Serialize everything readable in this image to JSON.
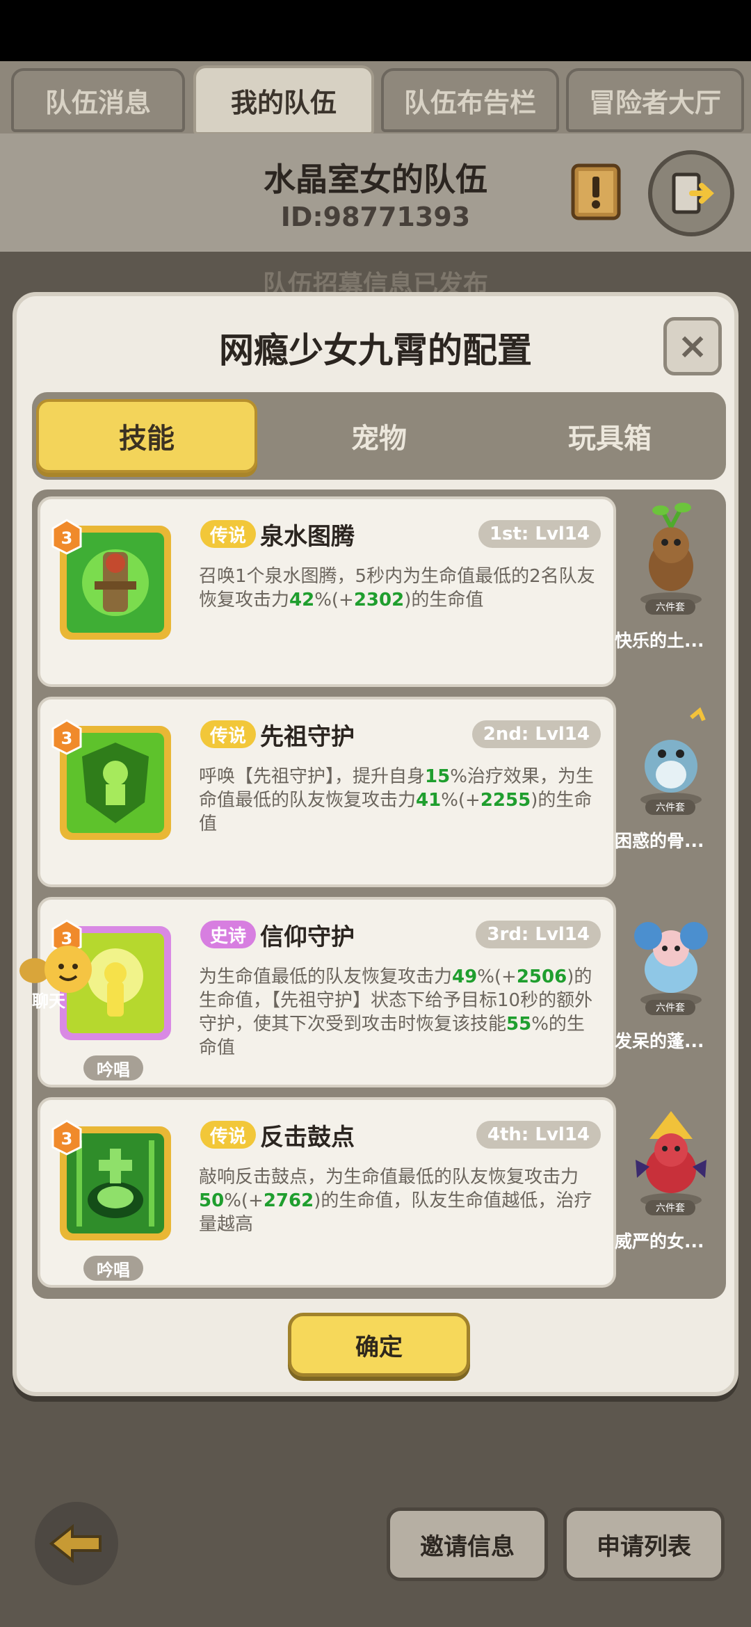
{
  "top_tabs": [
    "队伍消息",
    "我的队伍",
    "队伍布告栏",
    "冒险者大厅"
  ],
  "team": {
    "name": "水晶室女的队伍",
    "id": "ID:98771393",
    "banner": "队伍招募信息已发布"
  },
  "modal": {
    "title": "网瘾少女九霄的配置",
    "close_symbol": "×",
    "tabs": [
      "技能",
      "宠物",
      "玩具箱"
    ],
    "confirm_label": "确定"
  },
  "skills": [
    {
      "rarity": "传说",
      "name": "泉水图腾",
      "level": "1st: Lvl14",
      "badge": "3",
      "chant": "",
      "desc_parts": [
        "召唤1个泉水图腾，5秒内为生命值最低的2名队友恢复攻击力",
        "42",
        "%(+",
        "2302",
        ")的生命值"
      ]
    },
    {
      "rarity": "传说",
      "name": "先祖守护",
      "level": "2nd: Lvl14",
      "badge": "3",
      "chant": "",
      "desc_parts": [
        "呼唤【先祖守护】，提升自身",
        "15",
        "%治疗效果，为生命值最低的队友恢复攻击力",
        "41",
        "%(+",
        "2255",
        ")的生命值"
      ]
    },
    {
      "rarity": "史诗",
      "name": "信仰守护",
      "level": "3rd: Lvl14",
      "badge": "3",
      "chant": "吟唱",
      "desc_parts": [
        "为生命值最低的队友恢复攻击力",
        "49",
        "%(+",
        "2506",
        ")的生命值，【先祖守护】状态下给予目标10秒的额外守护，使其下次受到攻击时恢复该技能",
        "55",
        "%的生命值"
      ]
    },
    {
      "rarity": "传说",
      "name": "反击鼓点",
      "level": "4th: Lvl14",
      "badge": "3",
      "chant": "吟唱",
      "desc_parts": [
        "敲响反击鼓点，为生命值最低的队友恢复攻击力",
        "50",
        "%(+",
        "2762",
        ")的生命值，队友生命值越低，治疗量越高"
      ]
    }
  ],
  "pets": [
    {
      "name": "快乐的土...",
      "set_tag": "六件套"
    },
    {
      "name": "困惑的骨...",
      "set_tag": "六件套"
    },
    {
      "name": "发呆的蓬...",
      "set_tag": "六件套"
    },
    {
      "name": "威严的女...",
      "set_tag": "六件套"
    }
  ],
  "chat_label": "聊天",
  "bottom_buttons": {
    "invite": "邀请信息",
    "apply": "申请列表"
  },
  "colors": {
    "gold": "#f3d45a",
    "legend": "#f2c739",
    "epic": "#d77ee0",
    "heal_green": "#1f9e2e"
  }
}
